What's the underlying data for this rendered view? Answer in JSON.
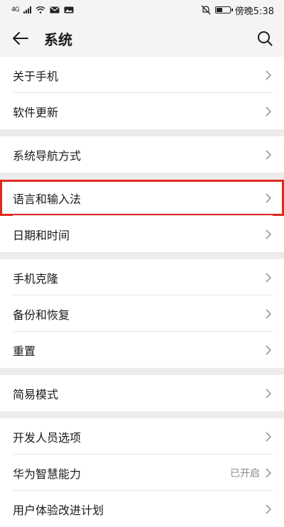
{
  "status_bar": {
    "network": "4G",
    "time": "傍晚5:38",
    "icons": [
      "signal-icon",
      "wifi-icon",
      "mail-icon",
      "image-icon",
      "mute-icon",
      "battery-icon"
    ]
  },
  "header": {
    "title": "系统"
  },
  "groups": [
    {
      "items": [
        {
          "label": "关于手机"
        },
        {
          "label": "软件更新"
        }
      ]
    },
    {
      "items": [
        {
          "label": "系统导航方式"
        }
      ]
    },
    {
      "items": [
        {
          "label": "语言和输入法",
          "highlighted": true
        },
        {
          "label": "日期和时间"
        }
      ]
    },
    {
      "items": [
        {
          "label": "手机克隆"
        },
        {
          "label": "备份和恢复"
        },
        {
          "label": "重置"
        }
      ]
    },
    {
      "items": [
        {
          "label": "简易模式"
        }
      ]
    },
    {
      "items": [
        {
          "label": "开发人员选项"
        },
        {
          "label": "华为智慧能力",
          "value": "已开启"
        },
        {
          "label": "用户体验改进计划"
        }
      ]
    }
  ],
  "colors": {
    "highlight": "#e02a1f",
    "background": "#f2f2f2"
  }
}
